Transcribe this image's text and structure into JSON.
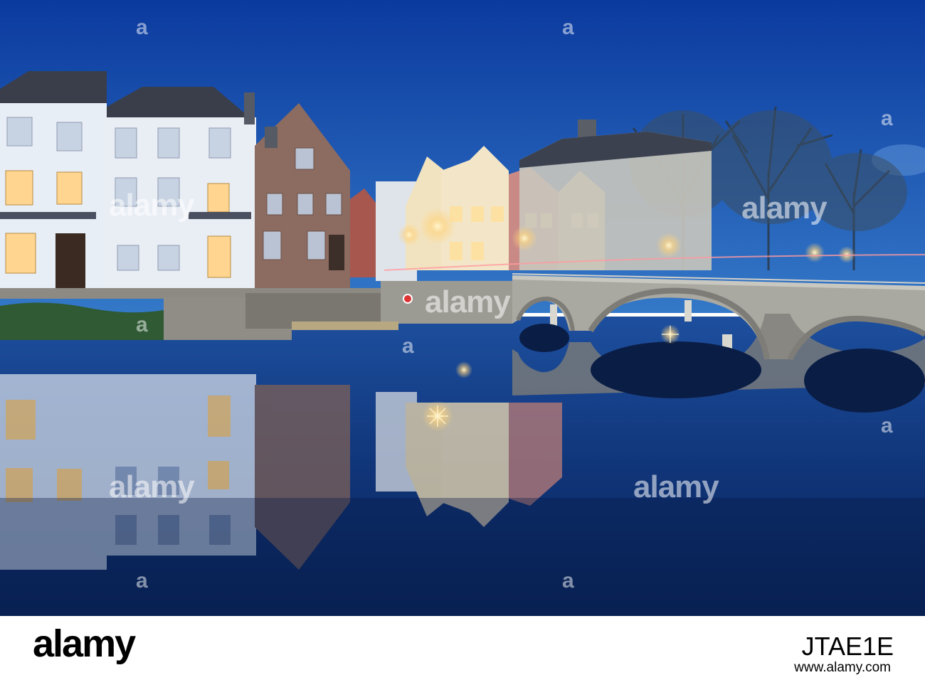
{
  "watermark": {
    "text": "alamy",
    "dot": "a"
  },
  "footer": {
    "logo": "alamy",
    "image_id": "JTAE1E",
    "url": "www.alamy.com"
  },
  "colors": {
    "sky_top": "#0f3fa3",
    "sky_bottom": "#2f72c9",
    "water": "#0c2a66",
    "warm_light": "#ffd58a",
    "stone": "#b8b6ae"
  }
}
